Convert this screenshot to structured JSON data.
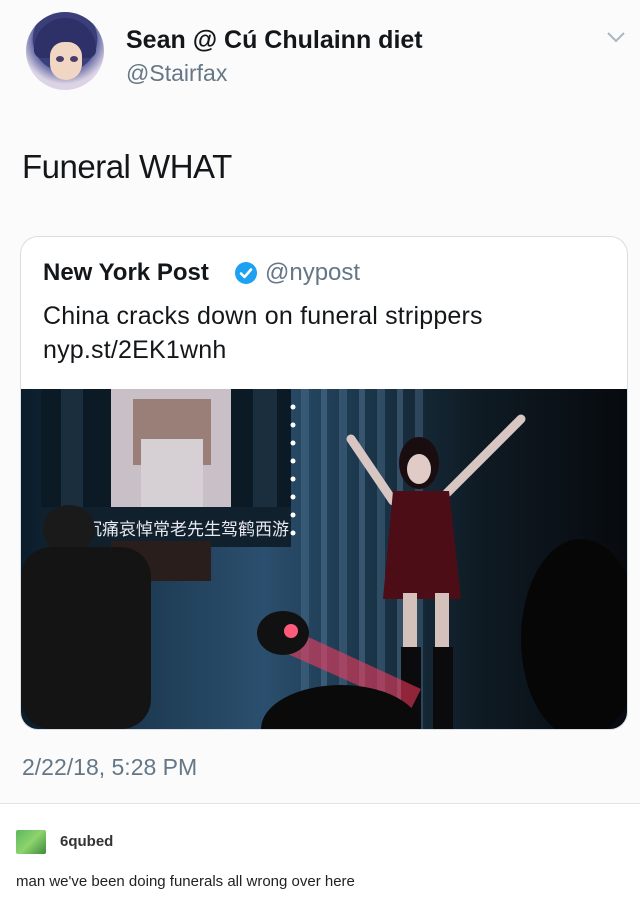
{
  "tweet": {
    "display_name": "Sean @ Cú Chulainn diet",
    "handle": "@Stairfax",
    "text": "Funeral WHAT",
    "timestamp": "2/22/18, 5:28 PM",
    "icons": [
      "avatar",
      "chevron-down-icon"
    ]
  },
  "quoted_tweet": {
    "name": "New York Post",
    "handle": "@nypost",
    "text_line1": "China cracks down on funeral strippers",
    "text_line2": "nyp.st/2EK1wnh",
    "verified_color": "#1da1f2",
    "image_banner_text": "沉痛哀悼常老先生驾鹤西游"
  },
  "reply": {
    "username": "6qubed",
    "text": "man we've been doing funerals all wrong over here"
  },
  "colors": {
    "accent": "#1da1f2",
    "muted_text": "#657786"
  }
}
